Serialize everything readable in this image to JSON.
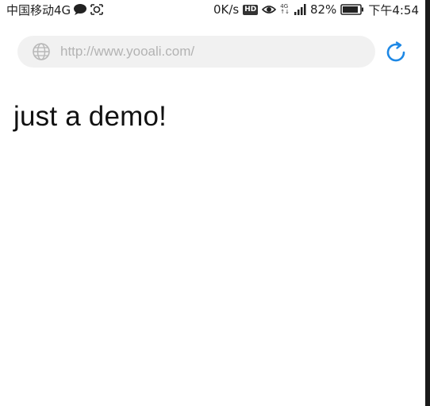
{
  "status_bar": {
    "carrier": "中国移动4G",
    "net_speed": "0K/s",
    "hd": "HD",
    "network_top": "4G",
    "network_bottom": "↑↓",
    "battery": "82%",
    "time": "下午4:54",
    "icons": [
      "chat-bubble-icon",
      "screen-record-icon",
      "eye-icon",
      "signal-icon",
      "battery-icon"
    ]
  },
  "browser": {
    "url_placeholder": "http://www.yooali.com/",
    "url_icon": "globe-icon",
    "reload_icon": "reload-icon",
    "accent_color": "#1e88e5"
  },
  "page": {
    "content": "just a demo!"
  }
}
